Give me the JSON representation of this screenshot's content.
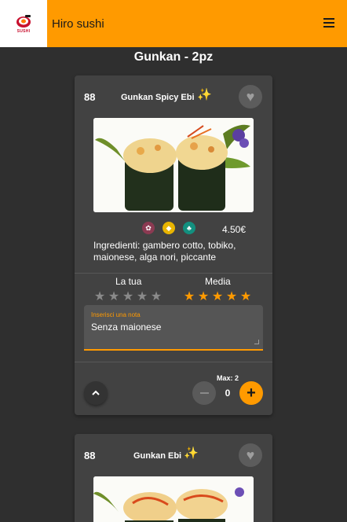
{
  "app": {
    "title": "Hiro sushi",
    "logo_text": "SUSHI",
    "menu_icon": "hamburger-menu-icon"
  },
  "section": {
    "title": "Gunkan - 2pz"
  },
  "colors": {
    "accent": "#ff9a00",
    "background": "#2f2f2f",
    "card": "#424242"
  },
  "products": [
    {
      "code": "88",
      "name": "Gunkan Spicy Ebi",
      "name_icon": "sparkles-icon",
      "favorite_icon": "heart-icon",
      "allergen_icons": [
        "crustacean-icon",
        "fish-icon",
        "mustard-icon"
      ],
      "price": "4.50€",
      "ingredients": "Ingredienti: gambero cotto, tobiko, maionese, alga nori, piccante",
      "rating": {
        "yours_label": "La tua",
        "yours_stars": 0,
        "average_label": "Media",
        "average_stars": 5,
        "max_stars": 5
      },
      "note": {
        "label": "Inserisci una nota",
        "value": "Senza maionese"
      },
      "max_label": "Max: 2",
      "quantity": "0"
    },
    {
      "code": "88",
      "name": "Gunkan Ebi",
      "name_icon": "sparkles-icon",
      "favorite_icon": "heart-icon"
    }
  ]
}
